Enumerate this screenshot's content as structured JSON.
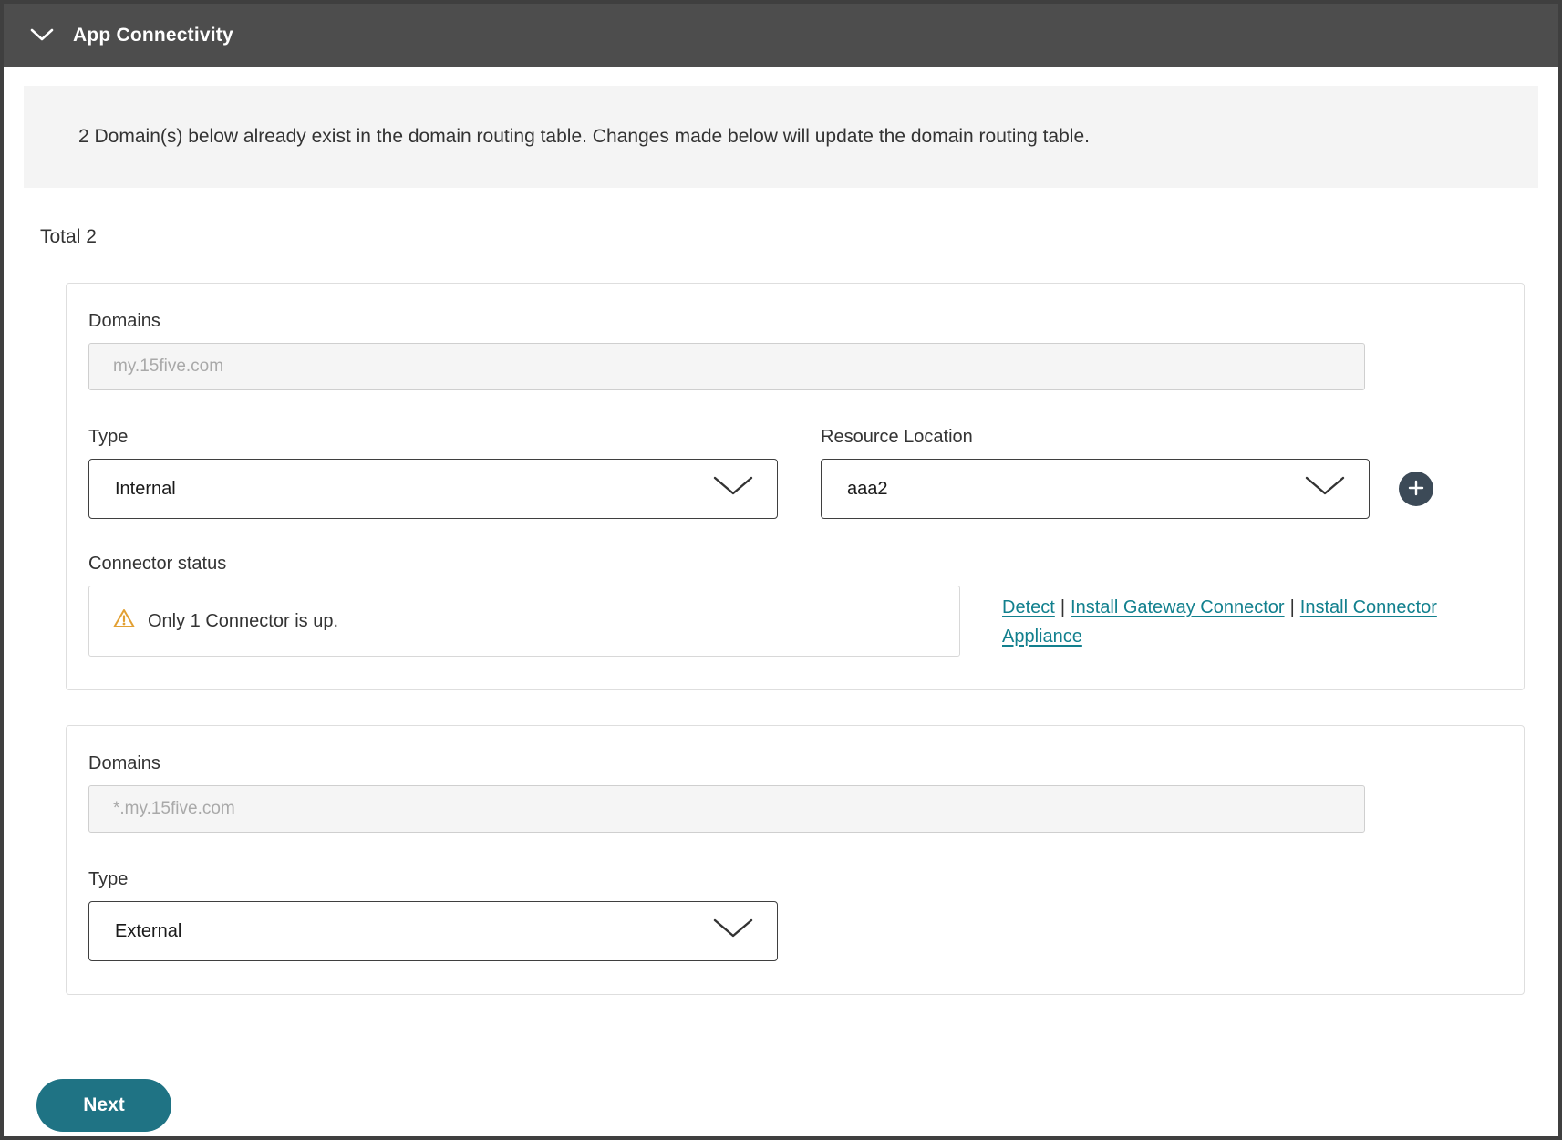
{
  "header": {
    "title": "App Connectivity"
  },
  "banner": {
    "text": "2 Domain(s) below already exist in the domain routing table. Changes made below will update the domain routing table."
  },
  "summary": {
    "total_label": "Total 2"
  },
  "cards": [
    {
      "domains_label": "Domains",
      "domain_placeholder": "my.15five.com",
      "type_label": "Type",
      "type_value": "Internal",
      "resource_location_label": "Resource Location",
      "resource_location_value": "aaa2",
      "connector_status_label": "Connector status",
      "connector_status_message": "Only 1 Connector is up.",
      "links": {
        "detect": "Detect",
        "install_gateway": "Install Gateway Connector",
        "install_appliance": "Install Connector Appliance"
      },
      "link_separator": "|"
    },
    {
      "domains_label": "Domains",
      "domain_placeholder": "*.my.15five.com",
      "type_label": "Type",
      "type_value": "External"
    }
  ],
  "footer": {
    "next_label": "Next"
  },
  "icons": {
    "header_chevron": "chevron-down-icon",
    "select_chevron": "chevron-down-icon",
    "add": "plus-icon",
    "warning": "warning-triangle-icon"
  },
  "colors": {
    "header_bg": "#4d4d4d",
    "banner_bg": "#f4f4f4",
    "link_accent": "#12808e",
    "next_button": "#1f7384",
    "warning": "#e2a033"
  }
}
